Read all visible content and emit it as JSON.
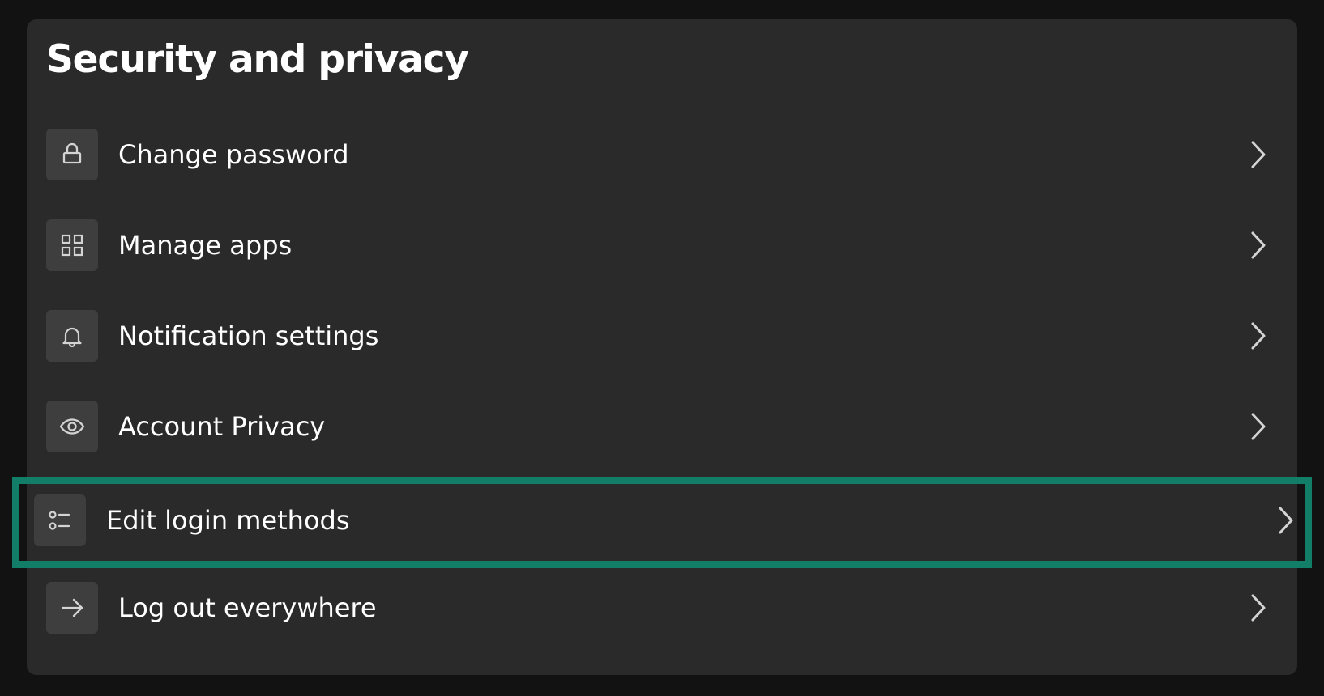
{
  "page": {
    "title": "Security and privacy"
  },
  "menu": {
    "items": [
      {
        "label": "Change password",
        "icon": "lock-icon"
      },
      {
        "label": "Manage apps",
        "icon": "grid-apps-icon"
      },
      {
        "label": "Notification settings",
        "icon": "bell-icon"
      },
      {
        "label": "Account Privacy",
        "icon": "eye-icon"
      },
      {
        "label": "Edit login methods",
        "icon": "list-options-icon",
        "highlighted": true
      },
      {
        "label": "Log out everywhere",
        "icon": "arrow-right-icon"
      }
    ]
  },
  "colors": {
    "background": "#121212",
    "panel": "#2a2a2a",
    "icon_box": "#3e3e3e",
    "highlight_border": "#137e67",
    "text": "#ffffff"
  }
}
